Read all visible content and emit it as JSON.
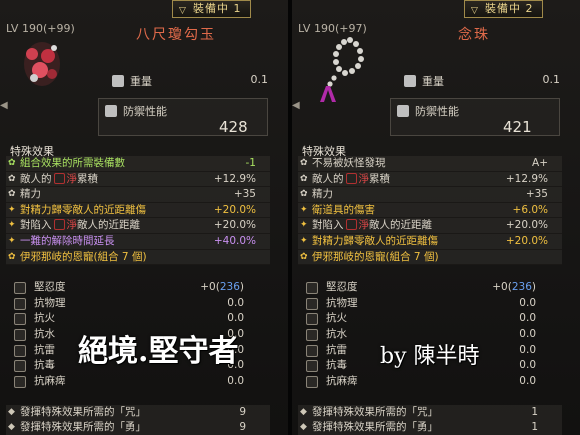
{
  "left": {
    "tab": "裝備中 1",
    "level": "LV 190",
    "level_plus": "(+99)",
    "name": "八尺瓊勾玉",
    "weight_label": "重量",
    "weight_value": "0.1",
    "defense_label": "防禦性能",
    "defense_value": "428",
    "special_title": "特殊效果",
    "effects": [
      {
        "label": "組合效果的所需裝備數",
        "value": "-1",
        "color": "green",
        "icon": "gear-icon"
      },
      {
        "label_pre": "敵人的",
        "label_red": "淨",
        "label_post": "累積",
        "value": "+12.9%",
        "color": "white",
        "icon": "gear-icon",
        "impure": true
      },
      {
        "label": "精力",
        "value": "+35",
        "color": "white",
        "icon": "gear-icon"
      },
      {
        "label": "對精力歸零敵人的近距離傷",
        "value": "+20.0%",
        "color": "gold",
        "icon": "star-icon"
      },
      {
        "label_pre": "對陷入",
        "label_red": "淨",
        "label_post": "敵人的近距離",
        "value": "+20.0%",
        "color": "white",
        "icon": "star-icon",
        "impure": true
      },
      {
        "label": "一難的解除時間延長",
        "value": "+40.0%",
        "color": "purple",
        "icon": "star-icon"
      },
      {
        "label": "伊邪那岐的恩寵(組合 7 個)",
        "value": "",
        "color": "gold",
        "icon": "gear-icon"
      }
    ],
    "toughness_label": "堅忍度",
    "toughness_value": "+0",
    "toughness_blue": "236",
    "resistances": [
      {
        "label": "抗物理",
        "value": "0.0"
      },
      {
        "label": "抗火",
        "value": "0.0"
      },
      {
        "label": "抗水",
        "value": "0.0"
      },
      {
        "label": "抗雷",
        "value": "0.0"
      },
      {
        "label": "抗毒",
        "value": "0.0"
      },
      {
        "label": "抗麻痺",
        "value": "0.0"
      }
    ],
    "ki_rows": [
      {
        "label": "發揮特殊效果所需的「咒」",
        "value": "9"
      },
      {
        "label": "發揮特殊效果所需的「勇」",
        "value": "9"
      }
    ],
    "caption": "絕境.堅守者"
  },
  "right": {
    "tab": "裝備中 2",
    "level": "LV 190",
    "level_plus": "(+97)",
    "name": "念珠",
    "weight_label": "重量",
    "weight_value": "0.1",
    "defense_label": "防禦性能",
    "defense_value": "421",
    "special_title": "特殊效果",
    "effects": [
      {
        "label": "不易被妖怪發現",
        "value": "A+",
        "color": "white",
        "icon": "gear-icon"
      },
      {
        "label_pre": "敵人的",
        "label_red": "淨",
        "label_post": "累積",
        "value": "+12.9%",
        "color": "white",
        "icon": "gear-icon",
        "impure": true
      },
      {
        "label": "精力",
        "value": "+35",
        "color": "white",
        "icon": "gear-icon"
      },
      {
        "label": "衛道具的傷害",
        "value": "+6.0%",
        "color": "gold",
        "icon": "star-icon"
      },
      {
        "label_pre": "對陷入",
        "label_red": "淨",
        "label_post": "敵人的近距離",
        "value": "+20.0%",
        "color": "white",
        "icon": "star-icon",
        "impure": true
      },
      {
        "label": "對精力歸零敵人的近距離傷",
        "value": "+20.0%",
        "color": "gold",
        "icon": "star-icon"
      },
      {
        "label": "伊邪那岐的恩寵(組合 7 個)",
        "value": "",
        "color": "gold",
        "icon": "gear-icon"
      }
    ],
    "toughness_label": "堅忍度",
    "toughness_value": "+0",
    "toughness_blue": "236",
    "resistances": [
      {
        "label": "抗物理",
        "value": "0.0"
      },
      {
        "label": "抗火",
        "value": "0.0"
      },
      {
        "label": "抗水",
        "value": "0.0"
      },
      {
        "label": "抗雷",
        "value": "0.0"
      },
      {
        "label": "抗毒",
        "value": "0.0"
      },
      {
        "label": "抗麻痺",
        "value": "0.0"
      }
    ],
    "ki_rows": [
      {
        "label": "發揮特殊效果所需的「咒」",
        "value": "1"
      },
      {
        "label": "發揮特殊效果所需的「勇」",
        "value": "1"
      }
    ],
    "caption": "by 陳半時"
  },
  "colors": {
    "gold": "#f0c040",
    "green": "#a8e060",
    "purple": "#c890f0",
    "red": "#e04848",
    "blue": "#6aa0f0",
    "white": "#d8d2c6"
  }
}
